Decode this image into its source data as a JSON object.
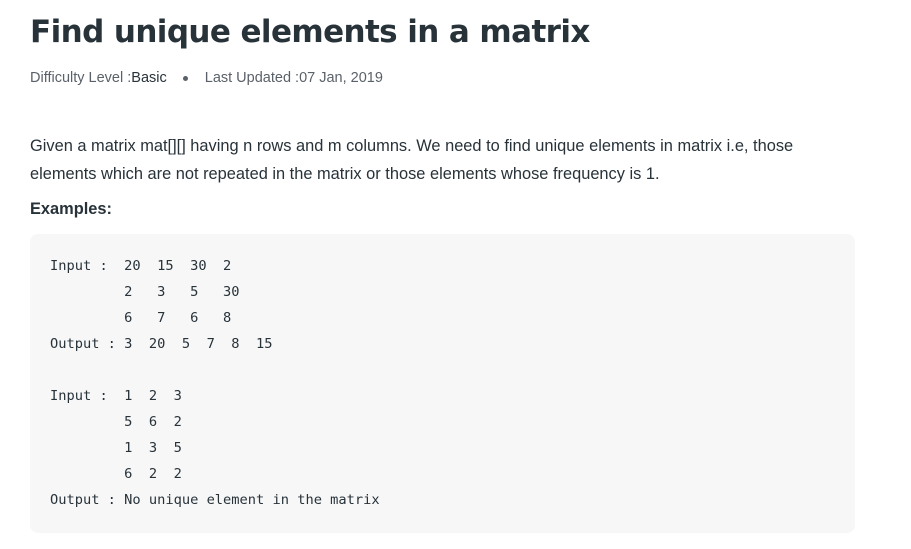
{
  "article": {
    "title": "Find unique elements in a matrix",
    "meta": {
      "difficulty_label": "Difficulty Level : ",
      "difficulty_value": "Basic",
      "updated_label": "Last Updated : ",
      "updated_value": "07 Jan, 2019"
    },
    "description": "Given a matrix mat[][] having n rows and m columns. We need to find unique elements in matrix i.e, those elements which are not repeated in the matrix or those elements whose frequency is 1.",
    "examples_heading": "Examples:",
    "code_lines": [
      "Input :  20  15  30  2",
      "         2   3   5   30",
      "         6   7   6   8",
      "Output : 3  20  5  7  8  15",
      "",
      "Input :  1  2  3",
      "         5  6  2",
      "         1  3  5",
      "         6  2  2",
      "Output : No unique element in the matrix"
    ]
  }
}
